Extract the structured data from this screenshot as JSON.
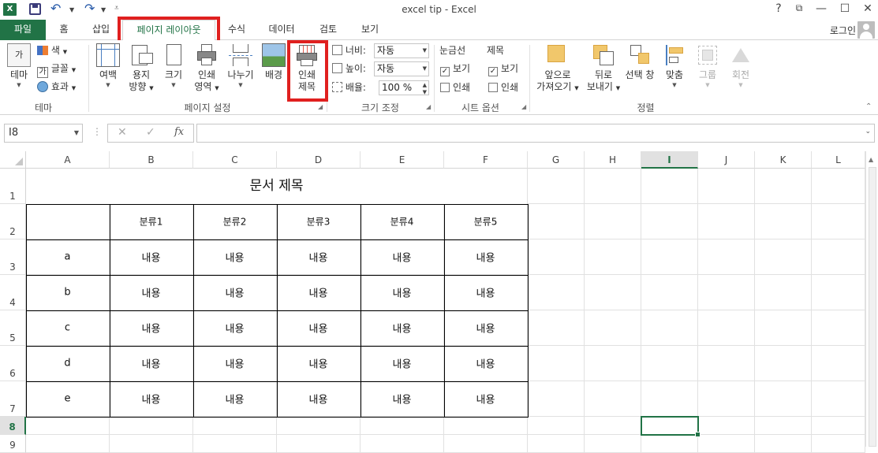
{
  "window": {
    "title": "excel tip - Excel",
    "help": "?",
    "restore": "⧉",
    "minimize": "—",
    "maximize": "☐",
    "close": "✕"
  },
  "qat": {
    "logo": "X"
  },
  "tabs": {
    "file": "파일",
    "items": [
      "홈",
      "삽입",
      "페이지 레이아웃",
      "수식",
      "데이터",
      "검토",
      "보기"
    ],
    "active": "페이지 레이아웃",
    "login": "로그인"
  },
  "ribbon": {
    "theme": {
      "themes_label": "테마",
      "colors": "색",
      "fonts": "글꼴",
      "effects": "효과",
      "group": "테마"
    },
    "page_setup": {
      "margins": "여백",
      "orientation_1": "용지",
      "orientation_2": "방향",
      "size": "크기",
      "print_area_1": "인쇄",
      "print_area_2": "영역",
      "breaks": "나누기",
      "background": "배경",
      "print_titles_1": "인쇄",
      "print_titles_2": "제목",
      "group": "페이지 설정"
    },
    "scale": {
      "width_label": "너비:",
      "width_value": "자동",
      "height_label": "높이:",
      "height_value": "자동",
      "scale_label": "배율:",
      "scale_value": "100 %",
      "group": "크기 조정"
    },
    "sheet_options": {
      "gridlines": "눈금선",
      "headings": "제목",
      "view": "보기",
      "print": "인쇄",
      "group": "시트 옵션"
    },
    "arrange": {
      "bring_forward_1": "앞으로",
      "bring_forward_2": "가져오기",
      "send_backward_1": "뒤로",
      "send_backward_2": "보내기",
      "selection_pane": "선택 창",
      "align": "맞춤",
      "group_btn": "그룹",
      "rotate": "회전",
      "group": "정렬"
    }
  },
  "formula_bar": {
    "name_box": "I8",
    "cancel": "✕",
    "enter": "✓",
    "fx": "fx",
    "content": ""
  },
  "sheet": {
    "columns": [
      "A",
      "B",
      "C",
      "D",
      "E",
      "F",
      "G",
      "H",
      "I",
      "J",
      "K",
      "L"
    ],
    "selected_column": "I",
    "rows": [
      "1",
      "2",
      "3",
      "4",
      "5",
      "6",
      "7",
      "8",
      "9"
    ],
    "selected_row": "8",
    "title": "문서 제목",
    "headers": [
      "",
      "분류1",
      "분류2",
      "분류3",
      "분류4",
      "분류5"
    ],
    "data": [
      [
        "a",
        "내용",
        "내용",
        "내용",
        "내용",
        "내용"
      ],
      [
        "b",
        "내용",
        "내용",
        "내용",
        "내용",
        "내용"
      ],
      [
        "c",
        "내용",
        "내용",
        "내용",
        "내용",
        "내용"
      ],
      [
        "d",
        "내용",
        "내용",
        "내용",
        "내용",
        "내용"
      ],
      [
        "e",
        "내용",
        "내용",
        "내용",
        "내용",
        "내용"
      ]
    ]
  },
  "colors": {
    "accent": "#217346",
    "highlight_box": "#e0201f"
  }
}
